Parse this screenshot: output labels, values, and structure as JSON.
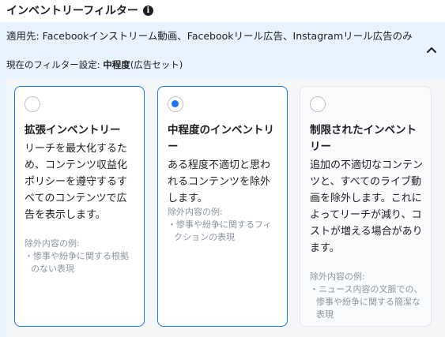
{
  "header": {
    "title": "インベントリーフィルター",
    "info_icon": "info-icon"
  },
  "panel": {
    "applies_to": "適用先: Facebookインストリーム動画、Facebookリール広告、Instagramリール広告のみ",
    "current_prefix": "現在のフィルター設定: ",
    "current_value": "中程度",
    "current_suffix": "(広告セット)",
    "collapse_icon": "chevron-up-icon"
  },
  "cards": [
    {
      "title": "拡張インベントリー",
      "description": "リーチを最大化するため、コンテンツ収益化ポリシーを遵守するすべてのコンテンツで広告を表示します。",
      "examples_label": "除外内容の例:",
      "examples": [
        "・惨事や紛争に関する根拠のない表現"
      ],
      "selected": false
    },
    {
      "title": "中程度のインベントリー",
      "description": "ある程度不適切と思われるコンテンツを除外します。",
      "examples_label": "除外内容の例:",
      "examples": [
        "・惨事や紛争に関するフィクションの表現"
      ],
      "selected": true
    },
    {
      "title": "制限されたインベントリー",
      "description": "追加の不適切なコンテンツと、すべてのライブ動画を除外します。これによってリーチが減り、コストが増える場合があります。",
      "examples_label": "除外内容の例:",
      "examples": [
        "・ニュース内容の文脈での、惨事や紛争に関する簡潔な表現"
      ],
      "selected": false
    }
  ],
  "colors": {
    "accent": "#1877f2",
    "panel_bg": "#e7f3ff",
    "muted_text": "#8d949e"
  }
}
